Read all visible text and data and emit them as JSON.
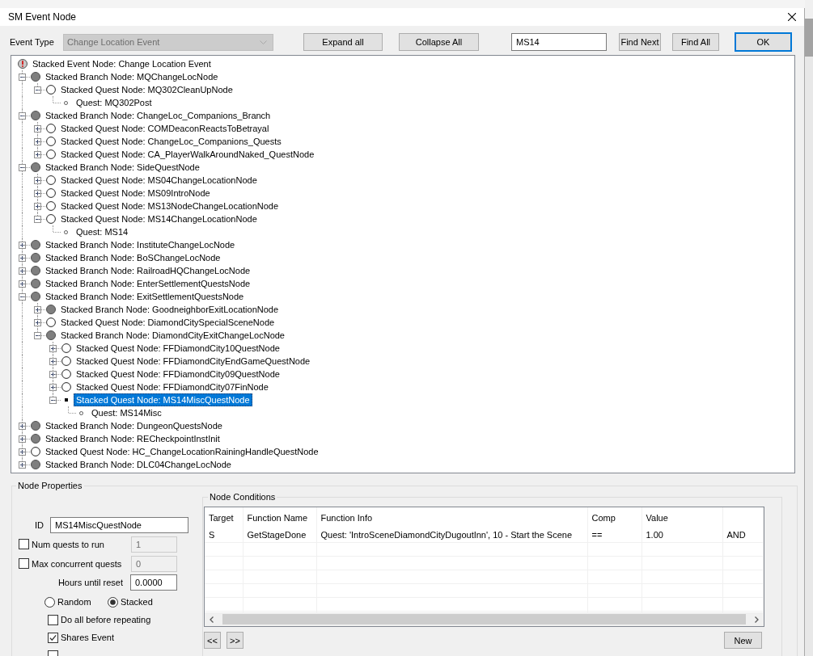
{
  "window": {
    "title": "SM Event Node"
  },
  "toolbar": {
    "event_type_label": "Event Type",
    "event_type": {
      "value": "Change Location Event",
      "disabled": true
    },
    "expand_all": "Expand all",
    "collapse_all": "Collapse All",
    "search": {
      "value": "MS14"
    },
    "find_next": "Find Next",
    "find_all": "Find All",
    "ok": "OK"
  },
  "tree": {
    "root": {
      "kind": "event",
      "label": "Stacked Event Node: Change Location Event",
      "selected": false,
      "children": [
        {
          "kind": "branch",
          "label": "Stacked Branch Node: MQChangeLocNode",
          "expanded": true,
          "selected": false,
          "children": [
            {
              "kind": "quest",
              "label": "Stacked Quest Node: MQ302CleanUpNode",
              "expanded": true,
              "selected": false,
              "children": [
                {
                  "kind": "quest-item",
                  "label": "Quest: MQ302Post",
                  "selected": false
                }
              ]
            }
          ]
        },
        {
          "kind": "branch",
          "label": "Stacked Branch Node: ChangeLoc_Companions_Branch",
          "expanded": true,
          "selected": false,
          "children": [
            {
              "kind": "quest",
              "label": "Stacked Quest Node: COMDeaconReactsToBetrayal",
              "expanded": false,
              "selected": false
            },
            {
              "kind": "quest",
              "label": "Stacked Quest Node: ChangeLoc_Companions_Quests",
              "expanded": false,
              "selected": false
            },
            {
              "kind": "quest",
              "label": "Stacked Quest Node: CA_PlayerWalkAroundNaked_QuestNode",
              "expanded": false,
              "selected": false
            }
          ]
        },
        {
          "kind": "branch",
          "label": "Stacked Branch Node: SideQuestNode",
          "expanded": true,
          "selected": false,
          "children": [
            {
              "kind": "quest",
              "label": "Stacked Quest Node: MS04ChangeLocationNode",
              "expanded": false,
              "selected": false
            },
            {
              "kind": "quest",
              "label": "Stacked Quest Node: MS09IntroNode",
              "expanded": false,
              "selected": false
            },
            {
              "kind": "quest",
              "label": "Stacked Quest Node: MS13NodeChangeLocationNode",
              "expanded": false,
              "selected": false
            },
            {
              "kind": "quest",
              "label": "Stacked Quest Node: MS14ChangeLocationNode",
              "expanded": true,
              "selected": false,
              "children": [
                {
                  "kind": "quest-item",
                  "label": "Quest: MS14",
                  "selected": false
                }
              ]
            }
          ]
        },
        {
          "kind": "branch",
          "label": "Stacked Branch Node: InstituteChangeLocNode",
          "expanded": false,
          "selected": false
        },
        {
          "kind": "branch",
          "label": "Stacked Branch Node: BoSChangeLocNode",
          "expanded": false,
          "selected": false
        },
        {
          "kind": "branch",
          "label": "Stacked Branch Node: RailroadHQChangeLocNode",
          "expanded": false,
          "selected": false
        },
        {
          "kind": "branch",
          "label": "Stacked Branch Node: EnterSettlementQuestsNode",
          "expanded": false,
          "selected": false
        },
        {
          "kind": "branch",
          "label": "Stacked Branch Node: ExitSettlementQuestsNode",
          "expanded": true,
          "selected": false,
          "children": [
            {
              "kind": "branch",
              "label": "Stacked Branch Node: GoodneighborExitLocationNode",
              "expanded": false,
              "selected": false
            },
            {
              "kind": "quest",
              "label": "Stacked Quest Node: DiamondCitySpecialSceneNode",
              "expanded": false,
              "selected": false
            },
            {
              "kind": "branch",
              "label": "Stacked Branch Node: DiamondCityExitChangeLocNode",
              "expanded": true,
              "selected": false,
              "children": [
                {
                  "kind": "quest",
                  "label": "Stacked Quest Node: FFDiamondCity10QuestNode",
                  "expanded": false,
                  "selected": false
                },
                {
                  "kind": "quest",
                  "label": "Stacked Quest Node: FFDiamondCityEndGameQuestNode",
                  "expanded": false,
                  "selected": false
                },
                {
                  "kind": "quest",
                  "label": "Stacked Quest Node: FFDiamondCity09QuestNode",
                  "expanded": false,
                  "selected": false
                },
                {
                  "kind": "quest",
                  "label": "Stacked Quest Node: FFDiamondCity07FinNode",
                  "expanded": false,
                  "selected": false
                },
                {
                  "kind": "quest",
                  "label": "Stacked Quest Node: MS14MiscQuestNode",
                  "expanded": true,
                  "selected": true,
                  "children": [
                    {
                      "kind": "quest-item",
                      "label": "Quest: MS14Misc",
                      "selected": false
                    }
                  ]
                }
              ]
            }
          ]
        },
        {
          "kind": "branch",
          "label": "Stacked Branch Node: DungeonQuestsNode",
          "expanded": false,
          "selected": false
        },
        {
          "kind": "branch",
          "label": "Stacked Branch Node: RECheckpointInstInit",
          "expanded": false,
          "selected": false
        },
        {
          "kind": "quest",
          "label": "Stacked Quest Node: HC_ChangeLocationRainingHandleQuestNode",
          "expanded": false,
          "selected": false
        },
        {
          "kind": "branch",
          "label": "Stacked Branch Node: DLC04ChangeLocNode",
          "expanded": false,
          "selected": false
        }
      ]
    }
  },
  "node_properties": {
    "title": "Node Properties",
    "id": {
      "label": "ID",
      "value": "MS14MiscQuestNode"
    },
    "num_quests": {
      "label": "Num quests to run",
      "checked": false,
      "value": "1",
      "disabled": true
    },
    "max_concurrent": {
      "label": "Max concurrent quests",
      "checked": false,
      "value": "0",
      "disabled": true
    },
    "hours_until_reset": {
      "label": "Hours until reset",
      "value": "0.0000"
    },
    "order": [
      {
        "label": "Random",
        "selected": false
      },
      {
        "label": "Stacked",
        "selected": true
      }
    ],
    "options": [
      {
        "label": "Do all before repeating",
        "checked": false
      },
      {
        "label": "Shares Event",
        "checked": true
      },
      {
        "checked": false
      }
    ]
  },
  "conditions": {
    "title": "Node Conditions",
    "columns": [
      "Target",
      "Function Name",
      "Function Info",
      "Comp",
      "Value"
    ],
    "rows": [
      [
        "S",
        "GetStageDone",
        "Quest: 'IntroSceneDiamondCityDugoutInn', 10 - Start the Scene",
        "==",
        "1.00",
        "AND"
      ]
    ],
    "prev_button": "<<",
    "next_button": ">>",
    "new_button": "New"
  }
}
